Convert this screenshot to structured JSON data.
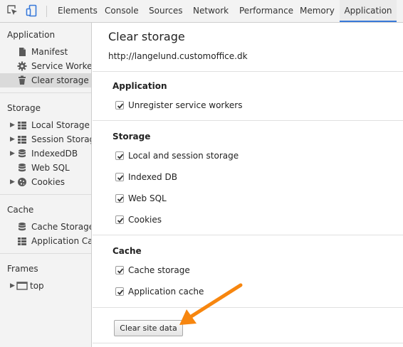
{
  "toolbar": {
    "inspect_icon": "cursor-select-icon",
    "device_icon": "device-mode-icon",
    "tabs": [
      {
        "label": "Elements"
      },
      {
        "label": "Console"
      },
      {
        "label": "Sources"
      },
      {
        "label": "Network"
      },
      {
        "label": "Performance"
      },
      {
        "label": "Memory"
      },
      {
        "label": "Application",
        "active": true
      }
    ]
  },
  "sidebar": {
    "application": {
      "header": "Application",
      "items": [
        {
          "label": "Manifest",
          "icon": "document-icon"
        },
        {
          "label": "Service Workers",
          "icon": "gear-icon"
        },
        {
          "label": "Clear storage",
          "icon": "trash-icon",
          "selected": true
        }
      ]
    },
    "storage": {
      "header": "Storage",
      "items": [
        {
          "label": "Local Storage",
          "icon": "grid-icon",
          "expandable": true
        },
        {
          "label": "Session Storage",
          "icon": "grid-icon",
          "expandable": true
        },
        {
          "label": "IndexedDB",
          "icon": "database-icon",
          "expandable": true
        },
        {
          "label": "Web SQL",
          "icon": "database-icon",
          "expandable": false
        },
        {
          "label": "Cookies",
          "icon": "cookie-icon",
          "expandable": true
        }
      ]
    },
    "cache": {
      "header": "Cache",
      "items": [
        {
          "label": "Cache Storage",
          "icon": "database-icon"
        },
        {
          "label": "Application Cache",
          "icon": "grid-icon"
        }
      ]
    },
    "frames": {
      "header": "Frames",
      "items": [
        {
          "label": "top",
          "icon": "frame-icon",
          "expandable": true
        }
      ]
    }
  },
  "main": {
    "title": "Clear storage",
    "url": "http://langelund.customoffice.dk",
    "sections": [
      {
        "title": "Application",
        "options": [
          {
            "label": "Unregister service workers",
            "checked": true
          }
        ]
      },
      {
        "title": "Storage",
        "options": [
          {
            "label": "Local and session storage",
            "checked": true
          },
          {
            "label": "Indexed DB",
            "checked": true
          },
          {
            "label": "Web SQL",
            "checked": true
          },
          {
            "label": "Cookies",
            "checked": true
          }
        ]
      },
      {
        "title": "Cache",
        "options": [
          {
            "label": "Cache storage",
            "checked": true
          },
          {
            "label": "Application cache",
            "checked": true
          }
        ]
      }
    ],
    "clear_button": "Clear site data"
  },
  "colors": {
    "active_tab_underline": "#3879d9",
    "annotation_arrow": "#f7860f",
    "selected_item_bg": "#dadada"
  }
}
